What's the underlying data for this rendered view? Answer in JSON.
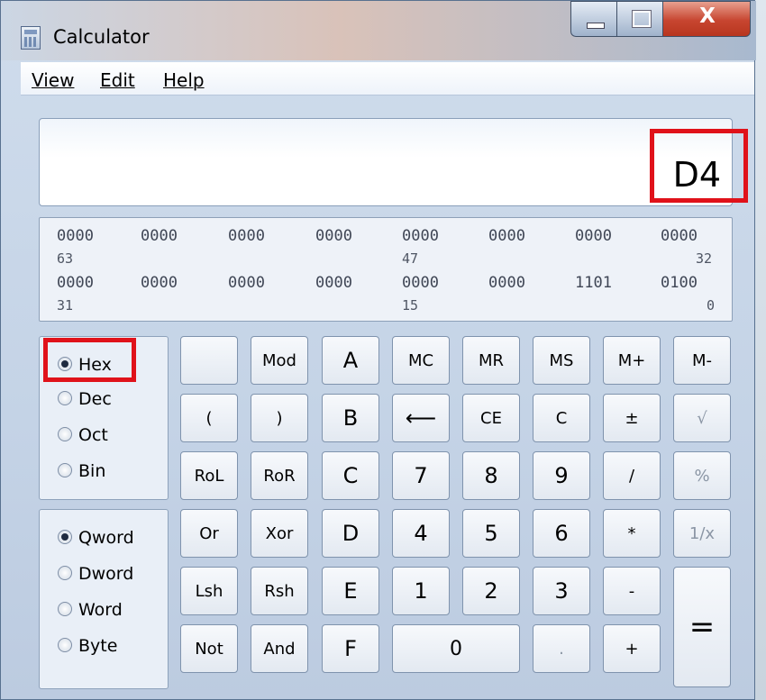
{
  "window": {
    "title": "Calculator",
    "close_glyph": "X"
  },
  "menu": [
    "View",
    "Edit",
    "Help"
  ],
  "display": {
    "value": "D4"
  },
  "bits": {
    "row1": [
      "0000",
      "0000",
      "0000",
      "0000",
      "0000",
      "0000",
      "0000",
      "0000"
    ],
    "pos1": [
      "63",
      "47",
      "32"
    ],
    "row2": [
      "0000",
      "0000",
      "0000",
      "0000",
      "0000",
      "0000",
      "1101",
      "0100"
    ],
    "pos2": [
      "31",
      "15",
      "0"
    ]
  },
  "base_modes": {
    "selected": "Hex",
    "options": [
      "Hex",
      "Dec",
      "Oct",
      "Bin"
    ]
  },
  "word_sizes": {
    "selected": "Qword",
    "options": [
      "Qword",
      "Dword",
      "Word",
      "Byte"
    ]
  },
  "keys": {
    "mod": "Mod",
    "a": "A",
    "mc": "MC",
    "mr": "MR",
    "ms": "MS",
    "mplus": "M+",
    "mminus": "M-",
    "lparen": "(",
    "rparen": ")",
    "b": "B",
    "back": "⟵",
    "ce": "CE",
    "c_clear": "C",
    "plusminus": "±",
    "sqrt": "√",
    "rol": "RoL",
    "ror": "RoR",
    "c_hex": "C",
    "seven": "7",
    "eight": "8",
    "nine": "9",
    "div": "/",
    "pct": "%",
    "or": "Or",
    "xor": "Xor",
    "d": "D",
    "four": "4",
    "five": "5",
    "six": "6",
    "mul": "*",
    "recip": "1/x",
    "lsh": "Lsh",
    "rsh": "Rsh",
    "e": "E",
    "one": "1",
    "two": "2",
    "three": "3",
    "minus": "-",
    "equals": "=",
    "not": "Not",
    "and": "And",
    "f": "F",
    "zero": "0",
    "dot": ".",
    "plus": "+"
  },
  "highlight_color": "#e0121a"
}
